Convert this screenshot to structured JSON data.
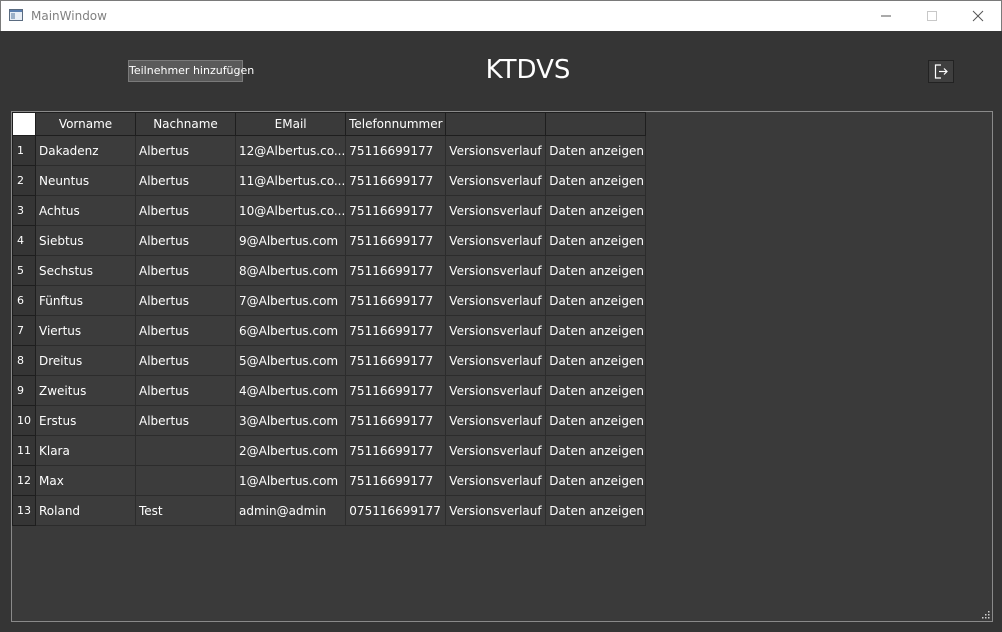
{
  "window": {
    "title": "MainWindow",
    "icon": "app-window-icon"
  },
  "header": {
    "add_button_label": "Teilnehmer hinzufügen",
    "app_title": "KTDVS",
    "logout_icon": "logout-icon"
  },
  "table": {
    "columns": [
      "Vorname",
      "Nachname",
      "EMail",
      "Telefonnummer",
      "",
      ""
    ],
    "rows": [
      {
        "num": "1",
        "vorname": "Dakadenz",
        "nachname": "Albertus",
        "email": "12@Albertus.co...",
        "telefon": "75116699177",
        "versions": "Versionsverlauf",
        "details": "Daten anzeigen"
      },
      {
        "num": "2",
        "vorname": "Neuntus",
        "nachname": "Albertus",
        "email": "11@Albertus.co...",
        "telefon": "75116699177",
        "versions": "Versionsverlauf",
        "details": "Daten anzeigen"
      },
      {
        "num": "3",
        "vorname": "Achtus",
        "nachname": "Albertus",
        "email": "10@Albertus.co...",
        "telefon": "75116699177",
        "versions": "Versionsverlauf",
        "details": "Daten anzeigen"
      },
      {
        "num": "4",
        "vorname": "Siebtus",
        "nachname": "Albertus",
        "email": "9@Albertus.com",
        "telefon": "75116699177",
        "versions": "Versionsverlauf",
        "details": "Daten anzeigen"
      },
      {
        "num": "5",
        "vorname": "Sechstus",
        "nachname": "Albertus",
        "email": "8@Albertus.com",
        "telefon": "75116699177",
        "versions": "Versionsverlauf",
        "details": "Daten anzeigen"
      },
      {
        "num": "6",
        "vorname": "Fünftus",
        "nachname": "Albertus",
        "email": "7@Albertus.com",
        "telefon": "75116699177",
        "versions": "Versionsverlauf",
        "details": "Daten anzeigen"
      },
      {
        "num": "7",
        "vorname": "Viertus",
        "nachname": "Albertus",
        "email": "6@Albertus.com",
        "telefon": "75116699177",
        "versions": "Versionsverlauf",
        "details": "Daten anzeigen"
      },
      {
        "num": "8",
        "vorname": "Dreitus",
        "nachname": "Albertus",
        "email": "5@Albertus.com",
        "telefon": "75116699177",
        "versions": "Versionsverlauf",
        "details": "Daten anzeigen"
      },
      {
        "num": "9",
        "vorname": "Zweitus",
        "nachname": "Albertus",
        "email": "4@Albertus.com",
        "telefon": "75116699177",
        "versions": "Versionsverlauf",
        "details": "Daten anzeigen"
      },
      {
        "num": "10",
        "vorname": "Erstus",
        "nachname": "Albertus",
        "email": "3@Albertus.com",
        "telefon": "75116699177",
        "versions": "Versionsverlauf",
        "details": "Daten anzeigen"
      },
      {
        "num": "11",
        "vorname": "Klara",
        "nachname": "",
        "email": "2@Albertus.com",
        "telefon": "75116699177",
        "versions": "Versionsverlauf",
        "details": "Daten anzeigen"
      },
      {
        "num": "12",
        "vorname": "Max",
        "nachname": "",
        "email": "1@Albertus.com",
        "telefon": "75116699177",
        "versions": "Versionsverlauf",
        "details": "Daten anzeigen"
      },
      {
        "num": "13",
        "vorname": "Roland",
        "nachname": "Test",
        "email": "admin@admin",
        "telefon": "075116699177",
        "versions": "Versionsverlauf",
        "details": "Daten anzeigen"
      }
    ]
  },
  "colors": {
    "background": "#353535",
    "cell": "#3c3c3c",
    "titlebar": "#ffffff"
  }
}
